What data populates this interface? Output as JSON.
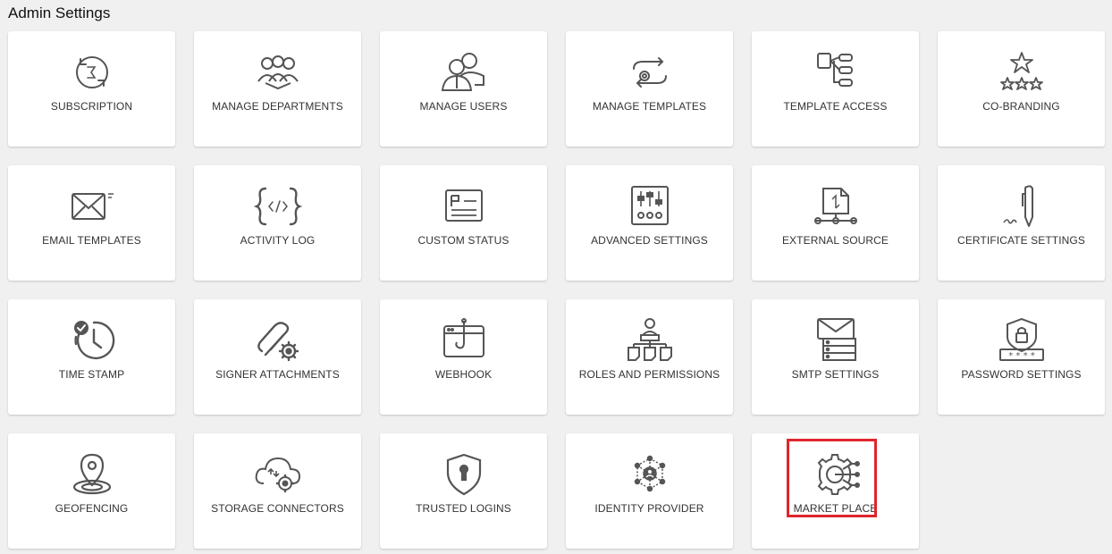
{
  "page": {
    "title": "Admin Settings"
  },
  "tiles": [
    {
      "label": "SUBSCRIPTION",
      "icon": "subscription-icon"
    },
    {
      "label": "MANAGE DEPARTMENTS",
      "icon": "departments-icon"
    },
    {
      "label": "MANAGE USERS",
      "icon": "users-icon"
    },
    {
      "label": "MANAGE TEMPLATES",
      "icon": "templates-icon"
    },
    {
      "label": "TEMPLATE ACCESS",
      "icon": "template-access-icon"
    },
    {
      "label": "CO-BRANDING",
      "icon": "co-branding-icon"
    },
    {
      "label": "EMAIL TEMPLATES",
      "icon": "email-templates-icon"
    },
    {
      "label": "ACTIVITY LOG",
      "icon": "activity-log-icon"
    },
    {
      "label": "CUSTOM STATUS",
      "icon": "custom-status-icon"
    },
    {
      "label": "ADVANCED SETTINGS",
      "icon": "advanced-settings-icon"
    },
    {
      "label": "EXTERNAL SOURCE",
      "icon": "external-source-icon"
    },
    {
      "label": "CERTIFICATE SETTINGS",
      "icon": "certificate-settings-icon"
    },
    {
      "label": "TIME STAMP",
      "icon": "time-stamp-icon"
    },
    {
      "label": "SIGNER ATTACHMENTS",
      "icon": "signer-attachments-icon"
    },
    {
      "label": "WEBHOOK",
      "icon": "webhook-icon"
    },
    {
      "label": "ROLES AND PERMISSIONS",
      "icon": "roles-permissions-icon"
    },
    {
      "label": "SMTP SETTINGS",
      "icon": "smtp-settings-icon"
    },
    {
      "label": "PASSWORD SETTINGS",
      "icon": "password-settings-icon"
    },
    {
      "label": "GEOFENCING",
      "icon": "geofencing-icon"
    },
    {
      "label": "STORAGE CONNECTORS",
      "icon": "storage-connectors-icon"
    },
    {
      "label": "TRUSTED LOGINS",
      "icon": "trusted-logins-icon"
    },
    {
      "label": "IDENTITY PROVIDER",
      "icon": "identity-provider-icon"
    },
    {
      "label": "MARKET PLACE",
      "icon": "market-place-icon"
    }
  ],
  "colors": {
    "icon": "#555555",
    "highlight": "#e0242c",
    "tile_bg": "#ffffff",
    "page_bg": "#f0f0f0"
  }
}
